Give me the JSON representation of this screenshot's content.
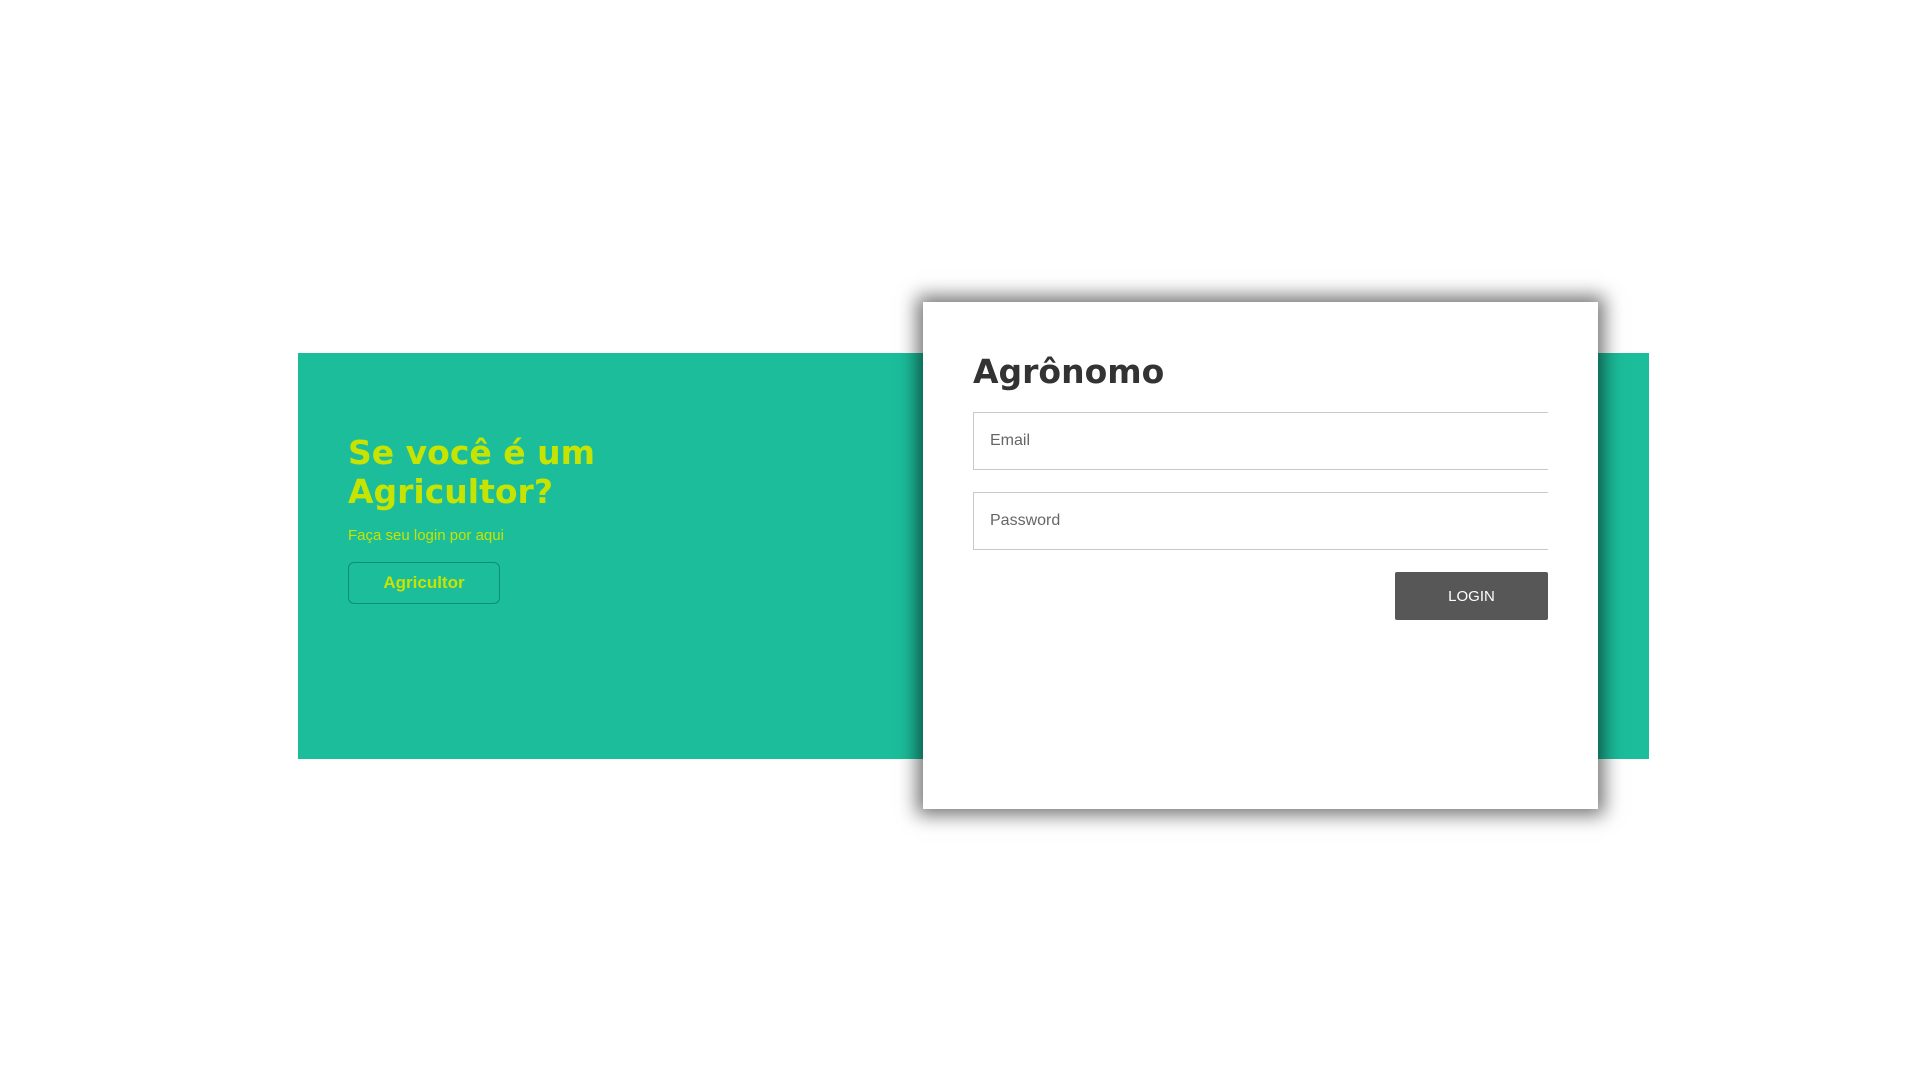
{
  "side_panel": {
    "title": "Se você é um Agricultor?",
    "subtitle": "Faça seu login por aqui",
    "button_label": "Agricultor"
  },
  "login_card": {
    "title": "Agrônomo",
    "email_placeholder": "Email",
    "password_placeholder": "Password",
    "login_label": "LOGIN"
  },
  "colors": {
    "band": "#1cbd9b",
    "accent": "#c6e400",
    "button": "#575757",
    "title_text": "#333333"
  }
}
